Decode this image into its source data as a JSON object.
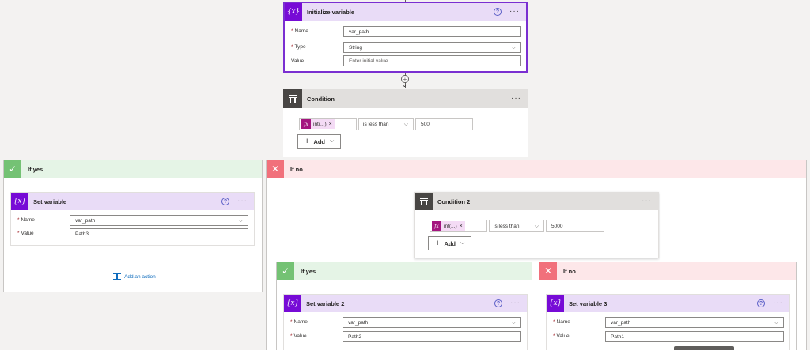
{
  "init_variable": {
    "title": "Initialize variable",
    "name_label": "Name",
    "name_value": "var_path",
    "type_label": "Type",
    "type_value": "String",
    "value_label": "Value",
    "value_placeholder": "Enter initial value",
    "icon": "curly-x-icon"
  },
  "condition": {
    "title": "Condition",
    "token_label": "int(...)",
    "operator": "is less than",
    "value": "500",
    "add_label": "Add"
  },
  "if_yes": {
    "title": "If yes",
    "set_variable": {
      "title": "Set variable",
      "name_label": "Name",
      "name_value": "var_path",
      "value_label": "Value",
      "value_value": "Path3"
    },
    "add_action_label": "Add an action"
  },
  "if_no": {
    "title": "If no",
    "condition2": {
      "title": "Condition 2",
      "token_label": "int(...)",
      "operator": "is less than",
      "value": "5000",
      "add_label": "Add"
    },
    "nested_yes": {
      "title": "If yes",
      "set_variable": {
        "title": "Set variable 2",
        "name_label": "Name",
        "name_value": "var_path",
        "value_label": "Value",
        "value_value": "Path2"
      }
    },
    "nested_no": {
      "title": "If no",
      "set_variable": {
        "title": "Set variable 3",
        "name_label": "Name",
        "name_value": "var_path",
        "value_label": "Value",
        "value_value": "Path1"
      }
    }
  },
  "colors": {
    "variable_purple": "#770bd6",
    "header_purple": "#e9dcf7",
    "yes_green": "#74c274",
    "no_red": "#f1707b",
    "expression_magenta": "#a4167f"
  }
}
